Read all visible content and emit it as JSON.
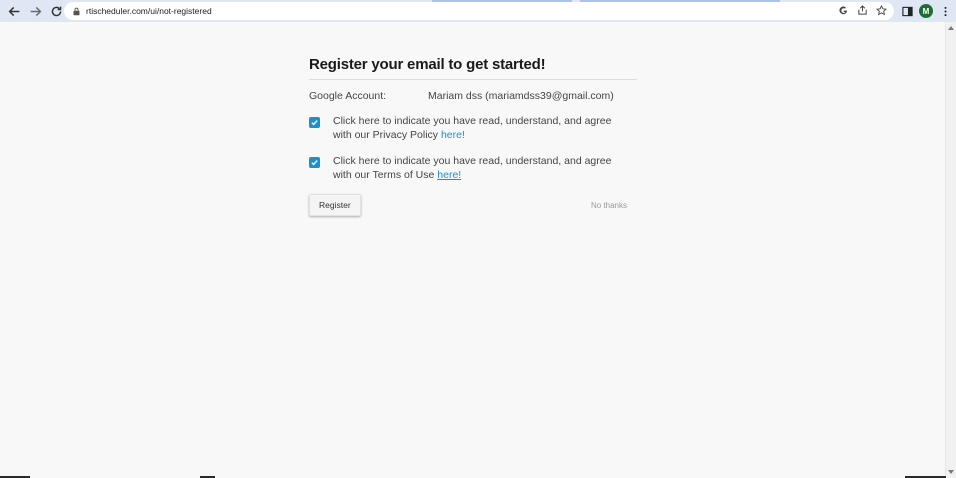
{
  "browser": {
    "url": "rtischeduler.com/ui/not-registered",
    "avatar_letter": "M",
    "avatar_color": "#1e6e34"
  },
  "page": {
    "title": "Register your email to get started!",
    "account_label": "Google Account:",
    "account_value": "Mariam dss (mariamdss39@gmail.com)",
    "privacy_text": "Click here to indicate you have read, understand, and agree with our Privacy Policy ",
    "privacy_link": "here!",
    "privacy_checked": true,
    "terms_text": "Click here to indicate you have read, understand, and agree with our Terms of Use ",
    "terms_link": "here!",
    "terms_checked": true,
    "register_label": "Register",
    "no_thanks_label": "No thanks"
  },
  "colors": {
    "accent": "#1f8fc9",
    "chrome": "#dfe7f5"
  }
}
